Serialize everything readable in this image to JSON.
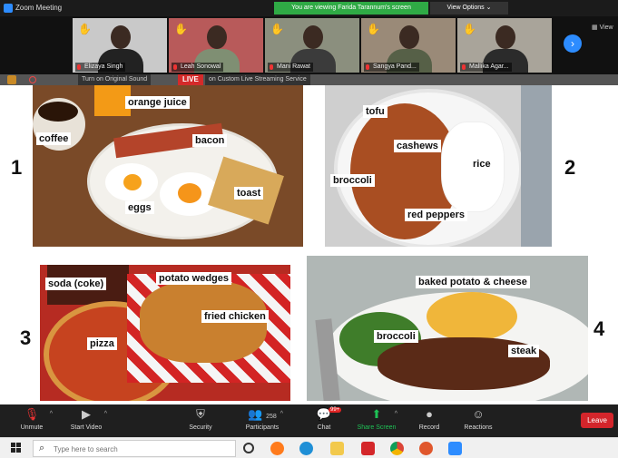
{
  "app": {
    "title": "Zoom Meeting",
    "share_banner": "You are viewing Farida Tarannum's screen",
    "view_options": "View Options ⌄"
  },
  "gallery": {
    "participants": [
      {
        "name": "Elizaya Singh"
      },
      {
        "name": "Leah Sonowal"
      },
      {
        "name": "Mani Rawat"
      },
      {
        "name": "Sangya Pand..."
      },
      {
        "name": "Mallika Agar..."
      }
    ],
    "view_label": "View"
  },
  "share_bar": {
    "audio_label": "Turn on Original Sound",
    "live_label": "LIVE",
    "stream_label": "on Custom Live Streaming Service"
  },
  "slide": {
    "meal1": {
      "number": "1",
      "labels": {
        "orange_juice": "orange juice",
        "coffee": "coffee",
        "bacon": "bacon",
        "eggs": "eggs",
        "toast": "toast"
      }
    },
    "meal2": {
      "number": "2",
      "labels": {
        "tofu": "tofu",
        "cashews": "cashews",
        "rice": "rice",
        "broccoli": "broccoli",
        "red_peppers": "red peppers"
      }
    },
    "meal3": {
      "number": "3",
      "labels": {
        "soda": "soda (coke)",
        "potato_wedges": "potato wedges",
        "fried_chicken": "fried chicken",
        "pizza": "pizza"
      }
    },
    "meal4": {
      "number": "4",
      "labels": {
        "baked_potato": "baked potato & cheese",
        "broccoli": "broccoli",
        "steak": "steak"
      }
    }
  },
  "toolbar": {
    "unmute": "Unmute",
    "start_video": "Start Video",
    "security": "Security",
    "participants": "Participants",
    "participants_count": "258",
    "chat": "Chat",
    "chat_badge": "99+",
    "share_screen": "Share Screen",
    "record": "Record",
    "reactions": "Reactions",
    "leave": "Leave"
  },
  "taskbar": {
    "search_placeholder": "Type here to search"
  },
  "colors": {
    "zoom_blue": "#2d8cff",
    "share_green": "#2faa45",
    "live_red": "#d42a2a",
    "leave_red": "#d3252b"
  }
}
